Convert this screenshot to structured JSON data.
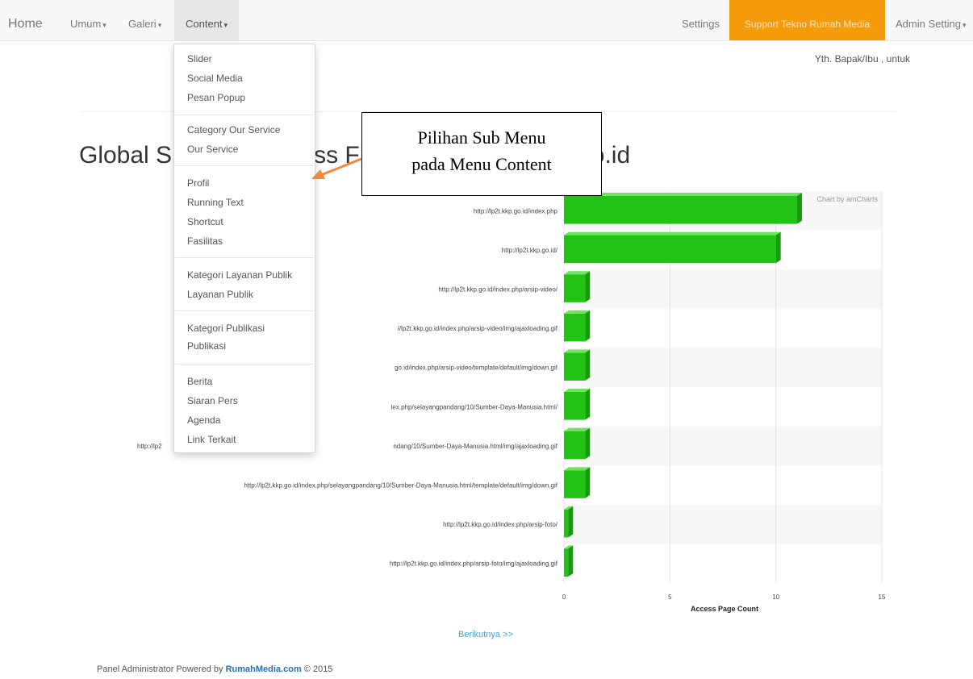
{
  "navbar": {
    "home": "Home",
    "umum": "Umum",
    "galeri": "Galeri",
    "content": "Content",
    "settings": "Settings",
    "support": "Support Tekno Rumah Media",
    "admin": "Admin Setting"
  },
  "greeting": "Yth. Bapak/Ibu , untuk",
  "page_title_left": "Global S",
  "page_title_mid": "ss F",
  "page_title_right": ".go.id",
  "dropdown": {
    "items": [
      "Slider",
      "Social Media",
      "Pesan Popup",
      "Category Our Service",
      "Our Service",
      "Profil",
      "Running Text",
      "Shortcut",
      "Fasilitas",
      "Kategori Layanan Publik",
      "Layanan Publik",
      "Kategori Publikasi",
      "Publikasi",
      "Berita",
      "Siaran Pers",
      "Agenda",
      "Link Terkait"
    ]
  },
  "annotation": {
    "line1": "Pilihan Sub Menu",
    "line2": "pada Menu Content"
  },
  "chart_data": {
    "type": "bar",
    "orientation": "horizontal",
    "categories": [
      "http://lp2t.kkp.go.id/index.php",
      "http://lp2t.kkp.go.id/",
      "http://lp2t.kkp.go.id/index.php/arsip-video/",
      "//lp2t.kkp.go.id/index.php/arsip-video/img/ajaxloading.gif",
      "go.id/index.php/arsip-video/template/default/img/down.gif",
      "lex.php/selayangpandang/10/Sumber-Daya-Manusia.html/",
      "ndang/10/Sumber-Daya-Manusia.html/img/ajaxloading.gif",
      "http://lp2t.kkp.go.id/index.php/selayangpandang/10/Sumber-Daya-Manusia.html/template/default/img/down.gif",
      "http://lp2t.kkp.go.id/index.php/arsip-foto/",
      "http://lp2t.kkp.go.id/index.php/arsip-foto/img/ajaxloading.gif"
    ],
    "values": [
      11,
      10,
      1,
      1,
      1,
      1,
      1,
      1,
      0.2,
      0.2
    ],
    "xlim": [
      0,
      15
    ],
    "xticks": [
      "0",
      "5",
      "10",
      "15"
    ],
    "xlabel": "Access Page Count",
    "credit": "Chart by amCharts",
    "partial_label": "http://lp2",
    "bar_color": "#22c314",
    "bar_top_color": "#6ee45f",
    "bar_side_color": "#159a0a"
  },
  "next_link": "Berikutnya >>",
  "footer": {
    "prefix": "Panel Administrator Powered by",
    "brand": "RumahMedia.com",
    "suffix": "© 2015"
  }
}
